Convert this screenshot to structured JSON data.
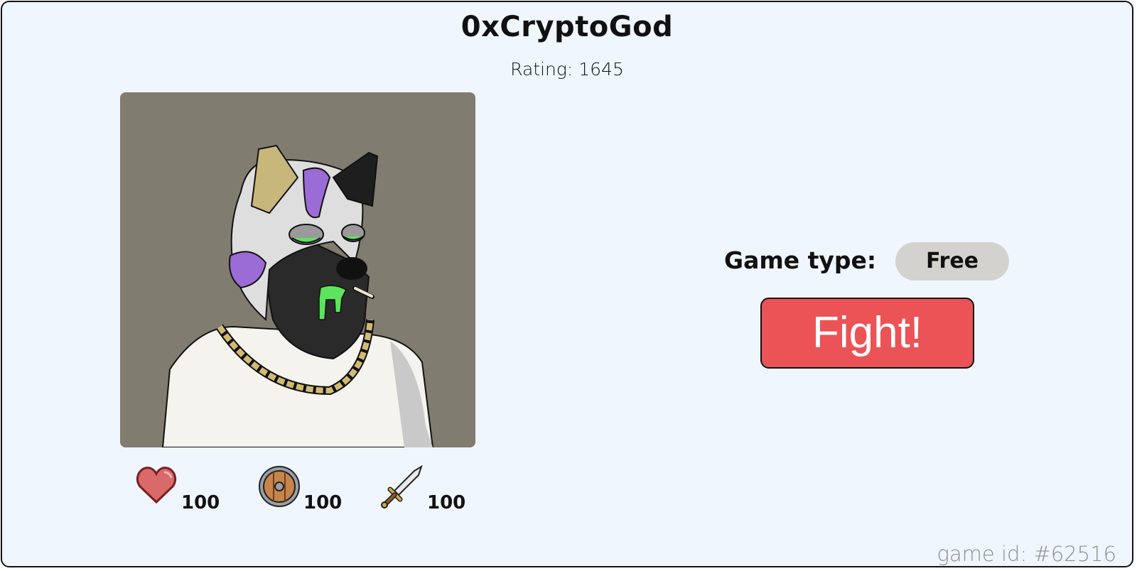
{
  "player": {
    "name": "0xCryptoGod",
    "rating": "Rating: 1645",
    "avatar_icon": "hyena-avatar"
  },
  "stats": {
    "health": {
      "icon": "heart-icon",
      "value": "100"
    },
    "defense": {
      "icon": "shield-icon",
      "value": "100"
    },
    "attack": {
      "icon": "sword-icon",
      "value": "100"
    }
  },
  "game": {
    "type_label": "Game type:",
    "type_value": "Free",
    "fight_label": "Fight!",
    "id_text": "game id: #62516"
  },
  "colors": {
    "background": "#eff6fd",
    "fight_button": "#eb5357",
    "pill": "#d4d2ce",
    "avatar_bg": "#817c70"
  }
}
